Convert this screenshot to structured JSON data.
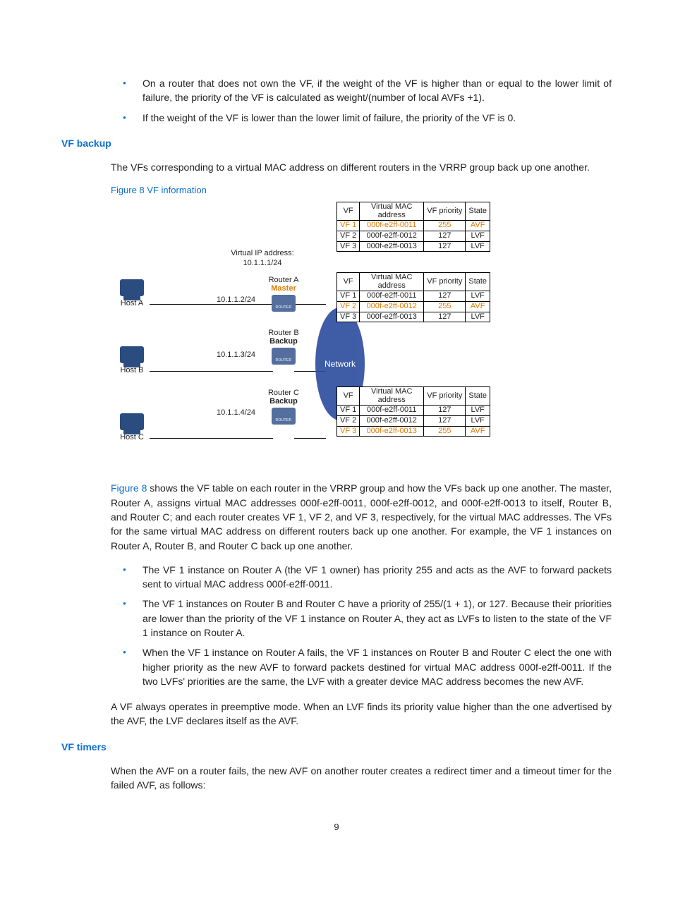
{
  "bullets_top": [
    "On a router that does not own the VF, if the weight of the VF is higher than or equal to the lower limit of failure, the priority of the VF is calculated as weight/(number of local AVFs +1).",
    "If the weight of the VF is lower than the lower limit of failure, the priority of the VF is 0."
  ],
  "h_vf_backup": "VF backup",
  "vf_backup_intro": "The VFs corresponding to a virtual MAC address on different routers in the VRRP group back up one another.",
  "fig_caption": "Figure 8 VF information",
  "diagram": {
    "hosts": [
      "Host A",
      "Host B",
      "Host C"
    ],
    "vip_label": "Virtual IP address:",
    "vip": "10.1.1.1/24",
    "routers": [
      {
        "name": "Router A",
        "type": "Master",
        "type_color": "#e07b00",
        "ip": "10.1.1.2/24"
      },
      {
        "name": "Router B",
        "type": "Backup",
        "type_color": "#000",
        "ip": "10.1.1.3/24"
      },
      {
        "name": "Router C",
        "type": "Backup",
        "type_color": "#000",
        "ip": "10.1.1.4/24"
      }
    ],
    "net_label": "Network",
    "table_headers": [
      "VF",
      "Virtual MAC address",
      "VF priority",
      "State"
    ],
    "tableA": [
      {
        "vf": "VF 1",
        "mac": "000f-e2ff-0011",
        "pri": "255",
        "st": "AVF",
        "hi": true
      },
      {
        "vf": "VF 2",
        "mac": "000f-e2ff-0012",
        "pri": "127",
        "st": "LVF",
        "hi": false
      },
      {
        "vf": "VF 3",
        "mac": "000f-e2ff-0013",
        "pri": "127",
        "st": "LVF",
        "hi": false
      }
    ],
    "tableB": [
      {
        "vf": "VF 1",
        "mac": "000f-e2ff-0011",
        "pri": "127",
        "st": "LVF",
        "hi": false
      },
      {
        "vf": "VF 2",
        "mac": "000f-e2ff-0012",
        "pri": "255",
        "st": "AVF",
        "hi": true
      },
      {
        "vf": "VF 3",
        "mac": "000f-e2ff-0013",
        "pri": "127",
        "st": "LVF",
        "hi": false
      }
    ],
    "tableC": [
      {
        "vf": "VF 1",
        "mac": "000f-e2ff-0011",
        "pri": "127",
        "st": "LVF",
        "hi": false
      },
      {
        "vf": "VF 2",
        "mac": "000f-e2ff-0012",
        "pri": "127",
        "st": "LVF",
        "hi": false
      },
      {
        "vf": "VF 3",
        "mac": "000f-e2ff-0013",
        "pri": "255",
        "st": "AVF",
        "hi": true
      }
    ]
  },
  "figref": "Figure 8",
  "after_fig_para": " shows the VF table on each router in the VRRP group and how the VFs back up one another. The master, Router A, assigns virtual MAC addresses 000f-e2ff-0011, 000f-e2ff-0012, and 000f-e2ff-0013 to itself, Router B, and Router C; and each router creates VF 1, VF 2, and VF 3, respectively, for the virtual MAC addresses. The VFs for the same virtual MAC address on different routers back up one another. For example, the VF 1 instances on Router A, Router B, and Router C back up one another.",
  "bullets_mid": [
    "The VF 1 instance on Router A (the VF 1 owner) has priority 255 and acts as the AVF to forward packets sent to virtual MAC address 000f-e2ff-0011.",
    "The VF 1 instances on Router B and Router C have a priority of 255/(1 + 1), or 127. Because their priorities are lower than the priority of the VF 1 instance on Router A, they act as LVFs to listen to the state of the VF 1 instance on Router A.",
    "When the VF 1 instance on Router A fails, the VF 1 instances on Router B and Router C elect the one with higher priority as the new AVF to forward packets destined for virtual MAC address 000f-e2ff-0011. If the two LVFs' priorities are the same, the LVF with a greater device MAC address becomes the new AVF."
  ],
  "preempt_para": "A VF always operates in preemptive mode. When an LVF finds its priority value higher than the one advertised by the AVF, the LVF declares itself as the AVF.",
  "h_vf_timers": "VF timers",
  "vf_timers_para": "When the AVF on a router fails, the new AVF on another router creates a redirect timer and a timeout timer for the failed AVF, as follows:",
  "page_num": "9"
}
